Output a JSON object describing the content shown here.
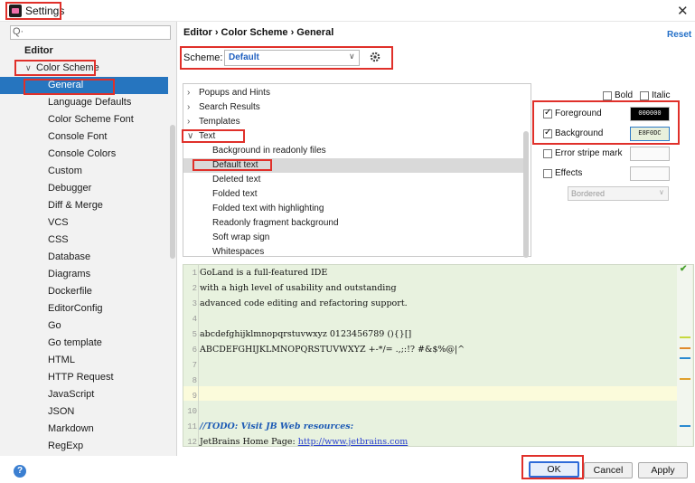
{
  "window": {
    "title": "Settings",
    "close": "✕"
  },
  "search": {
    "icon": "Q·"
  },
  "tree": {
    "items": [
      {
        "label": "Editor",
        "indent": 0,
        "bold": true,
        "expander": ""
      },
      {
        "label": "Color Scheme",
        "indent": 1,
        "bold": false,
        "expander": "∨"
      },
      {
        "label": "General",
        "indent": 2,
        "selected": true
      },
      {
        "label": "Language Defaults",
        "indent": 2
      },
      {
        "label": "Color Scheme Font",
        "indent": 2
      },
      {
        "label": "Console Font",
        "indent": 2
      },
      {
        "label": "Console Colors",
        "indent": 2
      },
      {
        "label": "Custom",
        "indent": 2
      },
      {
        "label": "Debugger",
        "indent": 2
      },
      {
        "label": "Diff & Merge",
        "indent": 2
      },
      {
        "label": "VCS",
        "indent": 2
      },
      {
        "label": "CSS",
        "indent": 2
      },
      {
        "label": "Database",
        "indent": 2
      },
      {
        "label": "Diagrams",
        "indent": 2
      },
      {
        "label": "Dockerfile",
        "indent": 2
      },
      {
        "label": "EditorConfig",
        "indent": 2
      },
      {
        "label": "Go",
        "indent": 2
      },
      {
        "label": "Go template",
        "indent": 2
      },
      {
        "label": "HTML",
        "indent": 2
      },
      {
        "label": "HTTP Request",
        "indent": 2
      },
      {
        "label": "JavaScript",
        "indent": 2
      },
      {
        "label": "JSON",
        "indent": 2
      },
      {
        "label": "Markdown",
        "indent": 2
      },
      {
        "label": "RegExp",
        "indent": 2
      }
    ]
  },
  "breadcrumb": {
    "text": "Editor  ›  Color Scheme  ›  General"
  },
  "reset": "Reset",
  "scheme": {
    "label": "Scheme:",
    "value": "Default"
  },
  "options": [
    {
      "label": "Popups and Hints",
      "arrow": "›"
    },
    {
      "label": "Search Results",
      "arrow": "›"
    },
    {
      "label": "Templates",
      "arrow": "›"
    },
    {
      "label": "Text",
      "arrow": "∨"
    },
    {
      "label": "Background in readonly files",
      "child": true
    },
    {
      "label": "Default text",
      "child": true,
      "selected": true
    },
    {
      "label": "Deleted text",
      "child": true
    },
    {
      "label": "Folded text",
      "child": true
    },
    {
      "label": "Folded text with highlighting",
      "child": true
    },
    {
      "label": "Readonly fragment background",
      "child": true
    },
    {
      "label": "Soft wrap sign",
      "child": true
    },
    {
      "label": "Whitespaces",
      "child": true
    }
  ],
  "attributes": {
    "bold": "Bold",
    "italic": "Italic",
    "foreground": {
      "label": "Foreground",
      "checked": true,
      "value": "000000",
      "color": "#000000"
    },
    "background": {
      "label": "Background",
      "checked": true,
      "value": "E8F0DC",
      "color": "#E8F0DC"
    },
    "error_stripe": {
      "label": "Error stripe mark",
      "checked": false
    },
    "effects": {
      "label": "Effects",
      "checked": false,
      "type": "Bordered"
    }
  },
  "preview": {
    "lines": [
      {
        "n": "1",
        "text": "GoLand is a full-featured IDE"
      },
      {
        "n": "2",
        "text": "with a high level of usability and outstanding"
      },
      {
        "n": "3",
        "text": "advanced code editing and refactoring support."
      },
      {
        "n": "4",
        "text": ""
      },
      {
        "n": "5",
        "text": "abcdefghijklmnopqrstuvwxyz 0123456789 (){}[]"
      },
      {
        "n": "6",
        "text": "ABCDEFGHIJKLMNOPQRSTUVWXYZ +-*/= .,;:!? #&$%@|^"
      },
      {
        "n": "7",
        "text": ""
      },
      {
        "n": "8",
        "text": ""
      },
      {
        "n": "9",
        "text": ""
      },
      {
        "n": "10",
        "text": ""
      },
      {
        "n": "11",
        "text": "//TODO: Visit JB Web resources:"
      },
      {
        "n": "12",
        "text": "JetBrains Home Page: ",
        "link": "http://www.jetbrains.com"
      }
    ]
  },
  "buttons": {
    "ok": "OK",
    "cancel": "Cancel",
    "apply": "Apply"
  },
  "help": "?"
}
